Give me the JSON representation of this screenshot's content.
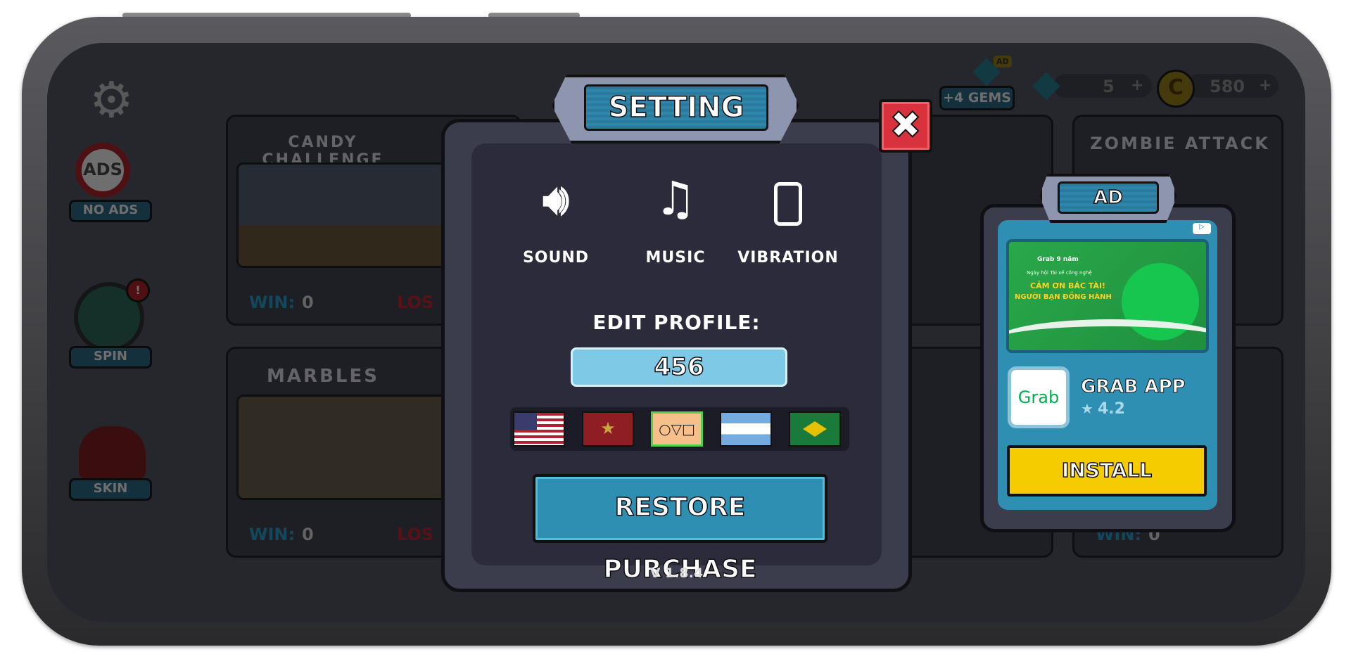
{
  "topbar": {
    "gems_reward_label": "+4 GEMS",
    "ad_tag": "AD",
    "gems_count": "5",
    "coins_count": "580",
    "plus": "+"
  },
  "sidebar": {
    "items": [
      {
        "label": "NO ADS",
        "icon": "no-ads-icon"
      },
      {
        "label": "SPIN",
        "icon": "spin-wheel-icon",
        "badge": "!"
      },
      {
        "label": "SKIN",
        "icon": "skin-icon"
      }
    ]
  },
  "games": [
    {
      "title": "CANDY CHALLENGE",
      "win_label": "WIN:",
      "win": "0",
      "lose_label": "LOS"
    },
    {
      "title": "MARBLES",
      "win_label": "WIN:",
      "win": "0",
      "lose_label": "LOS"
    },
    {
      "title": "ZOMBIE ATTACK"
    },
    {
      "title": "",
      "win_label": "WIN:",
      "win": "0"
    }
  ],
  "settings": {
    "title": "SETTING",
    "toggles": [
      {
        "label": "SOUND",
        "icon": "speaker-icon"
      },
      {
        "label": "MUSIC",
        "icon": "music-note-icon"
      },
      {
        "label": "VIBRATION",
        "icon": "vibration-icon"
      }
    ],
    "edit_profile_label": "EDIT PROFILE:",
    "profile_name": "456",
    "flags": [
      {
        "name": "usa"
      },
      {
        "name": "vietnam"
      },
      {
        "name": "squid-game",
        "selected": true,
        "symbols": "○▽□"
      },
      {
        "name": "argentina"
      },
      {
        "name": "brazil"
      }
    ],
    "restore_label": "RESTORE PURCHASE",
    "version": "V 1.8.4"
  },
  "ad": {
    "title": "AD",
    "banner_brand": "Grab 9 năm",
    "banner_sub": "Ngày hội Tài xế công nghệ",
    "banner_line1": "CẢM ƠN BÁC TÀI!",
    "banner_line2": "NGƯỜI BẠN ĐỒNG HÀNH",
    "app_logo": "Grab",
    "app_name": "GRAB APP",
    "rating": "4.2",
    "install_label": "INSTALL"
  },
  "colors": {
    "accent": "#2f86aa",
    "install": "#f5cc00",
    "close": "#d8323e",
    "input": "#7ec9e6"
  }
}
